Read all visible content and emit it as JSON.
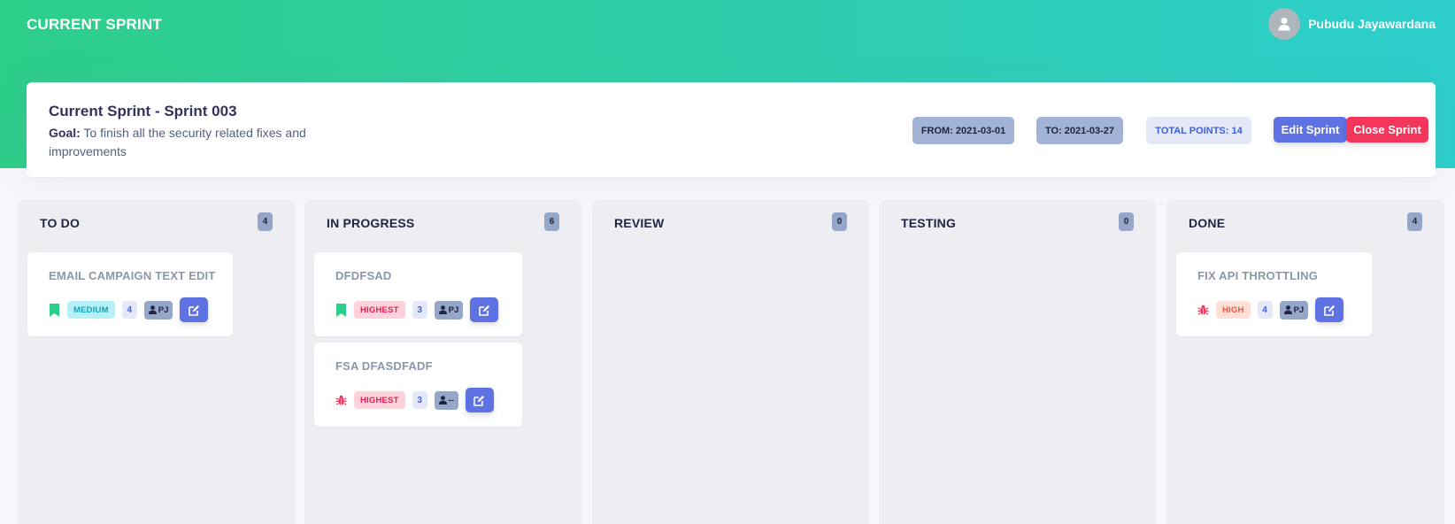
{
  "header": {
    "title": "CURRENT SPRINT",
    "user_name": "Pubudu Jayawardana",
    "avatar_icon": "user-icon"
  },
  "sprint": {
    "title": "Current Sprint - Sprint 003",
    "goal_label": "Goal:",
    "goal_text": "To finish all the security related fixes and improvements",
    "from": "FROM: 2021-03-01",
    "to": "TO: 2021-03-27",
    "total_points": "TOTAL POINTS: 14",
    "edit_label": "Edit Sprint",
    "close_label": "Close Sprint"
  },
  "columns": [
    {
      "title": "TO DO",
      "count": "4",
      "tasks": [
        {
          "title": "EMAIL CAMPAIGN TEXT EDIT",
          "type_icon": "bookmark-icon",
          "priority": "MEDIUM",
          "points": "4",
          "assignee": "PJ"
        }
      ]
    },
    {
      "title": "IN PROGRESS",
      "count": "6",
      "tasks": [
        {
          "title": "DFDFSAD",
          "type_icon": "bookmark-icon",
          "priority": "HIGHEST",
          "points": "3",
          "assignee": "PJ"
        },
        {
          "title": "FSA DFASDFADF",
          "type_icon": "bug-icon",
          "priority": "HIGHEST",
          "points": "3",
          "assignee": "--"
        }
      ]
    },
    {
      "title": "REVIEW",
      "count": "0",
      "tasks": []
    },
    {
      "title": "TESTING",
      "count": "0",
      "tasks": []
    },
    {
      "title": "DONE",
      "count": "4",
      "tasks": [
        {
          "title": "FIX API THROTTLING",
          "type_icon": "bug-icon",
          "priority": "HIGH",
          "points": "4",
          "assignee": "PJ"
        }
      ]
    }
  ],
  "colors": {
    "hero_start": "#2dce89",
    "hero_end": "#2dcecc",
    "primary": "#5e72e4",
    "danger": "#f5365c",
    "story_icon": "#2dce89",
    "bug_icon": "#f5365c"
  }
}
